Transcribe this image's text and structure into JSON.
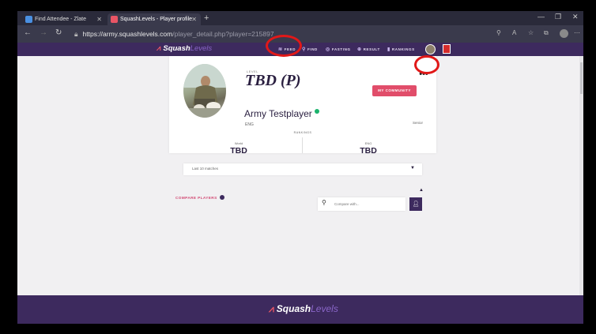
{
  "browser": {
    "tabs": [
      {
        "label": "Find Attendee - Zlate",
        "icon_color": "#4a90e2"
      },
      {
        "label": "SquashLevels - Player profile",
        "icon_color": "#e85565"
      }
    ],
    "new_tab": "+",
    "url_host": "https://army.squashlevels.com",
    "url_path": "/player_detail.php?player=215897",
    "window_controls": [
      "—",
      "❐",
      "✕"
    ]
  },
  "site_nav": {
    "logo_a": "Squash",
    "logo_b": "Levels",
    "items": [
      {
        "label": "FEED",
        "icon": "feed-icon"
      },
      {
        "label": "FIND",
        "icon": "search-icon"
      },
      {
        "label": "FASTING",
        "icon": "target-icon"
      },
      {
        "label": "RESULT",
        "icon": "plus-circle-icon"
      },
      {
        "label": "RANKINGS",
        "icon": "bar-chart-icon"
      }
    ]
  },
  "profile": {
    "level_label": "LEVEL",
    "level": "TBD (P)",
    "community_button": "MY COMMUNITY",
    "more": "•••",
    "name": "Army Testplayer",
    "country": "ENG",
    "status": "Senior",
    "rankings_label": "RANKINGS",
    "rank_world_label": "World",
    "rank_world_value": "TBD",
    "rank_country_label": "ENG",
    "rank_country_value": "TBD"
  },
  "matches": {
    "dropdown_label": "Last 10 matches"
  },
  "compare": {
    "label": "COMPARE PLAYERS",
    "placeholder": "Compare with..."
  },
  "footer": {
    "logo_a": "Squash",
    "logo_b": "Levels"
  },
  "colors": {
    "brand_purple": "#3d2a5e",
    "accent_pink": "#e14d6a",
    "annotation_red": "#e11818"
  }
}
